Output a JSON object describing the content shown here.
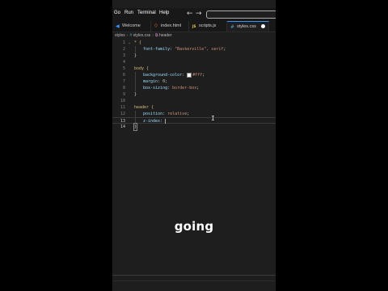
{
  "menu": {
    "items": [
      "Go",
      "Run",
      "Terminal",
      "Help"
    ],
    "back_arrow": "←",
    "forward_arrow": "→"
  },
  "tabs": [
    {
      "label": "Welcome",
      "icon": "vscode-icon",
      "icon_glyph": "◀",
      "icon_color": "#3794ff",
      "active": false
    },
    {
      "label": "index.html",
      "icon": "html-file-icon",
      "icon_glyph": "⟨⟩",
      "icon_color": "#e37933",
      "active": false
    },
    {
      "label": "scripts.js",
      "icon": "js-file-icon",
      "icon_glyph": "JS",
      "icon_color": "#e8d44d",
      "active": false
    },
    {
      "label": "styles.css",
      "icon": "css-file-icon",
      "icon_glyph": "#",
      "icon_color": "#519aba",
      "active": true,
      "modified": true
    }
  ],
  "breadcrumb": [
    "styles",
    "styles.css",
    "header"
  ],
  "editor": {
    "current_line": 13,
    "lines": [
      {
        "n": "1",
        "text": "* {"
      },
      {
        "n": "2",
        "prop": "font-family",
        "value": "\"Baskerville\", serif",
        "semi": ";"
      },
      {
        "n": "3",
        "text": "}"
      },
      {
        "n": "4",
        "text": ""
      },
      {
        "n": "5",
        "text": "body {"
      },
      {
        "n": "6",
        "prop": "background-color",
        "value": "#fff",
        "semi": ";"
      },
      {
        "n": "7",
        "prop": "margin",
        "value": "0",
        "semi": ";"
      },
      {
        "n": "8",
        "prop": "box-sizing",
        "value": "border-box",
        "semi": ";"
      },
      {
        "n": "9",
        "text": "}"
      },
      {
        "n": "10",
        "text": ""
      },
      {
        "n": "11",
        "text": "header {"
      },
      {
        "n": "12",
        "prop": "position",
        "value": "relative",
        "semi": ";"
      },
      {
        "n": "13",
        "prop": "z-index",
        "value": "",
        "semi": ""
      },
      {
        "n": "14",
        "text": "}"
      }
    ]
  },
  "caption": "going"
}
